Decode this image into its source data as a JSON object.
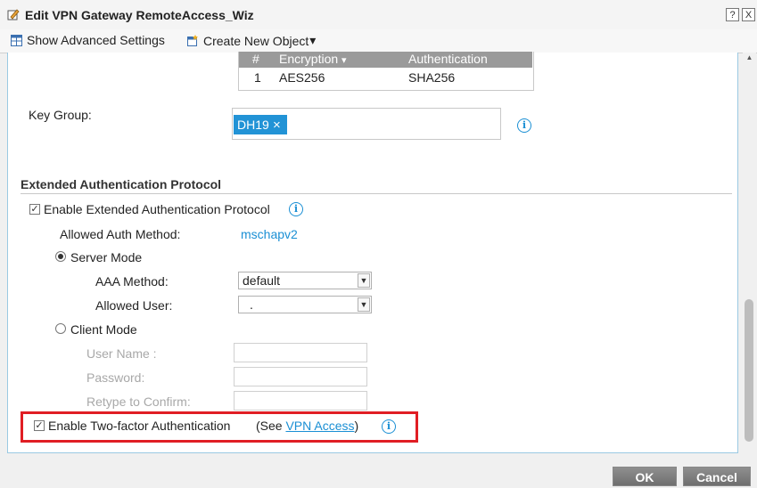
{
  "window": {
    "title": "Edit VPN Gateway RemoteAccess_Wiz",
    "help_label": "?",
    "close_label": "X"
  },
  "toolbar": {
    "show_advanced": "Show Advanced Settings",
    "create_object": "Create New Object",
    "create_object_arrow": "▾"
  },
  "proposal_table": {
    "headers": {
      "num": "#",
      "encryption": "Encryption",
      "authentication": "Authentication",
      "sort_icon": "▾"
    },
    "rows": [
      {
        "num": "1",
        "encryption": "AES256",
        "authentication": "SHA256"
      }
    ]
  },
  "key_group": {
    "label": "Key Group:",
    "tag": "DH19",
    "tag_remove": "×",
    "info_icon": "i"
  },
  "xauth": {
    "section_title": "Extended Authentication Protocol",
    "enable_label": "Enable Extended Authentication Protocol",
    "enable_checked": true,
    "check_mark": "✓",
    "info_icon": "i",
    "allowed_auth_label": "Allowed Auth Method:",
    "allowed_auth_value": "mschapv2",
    "server_mode_label": "Server Mode",
    "aaa_method_label": "AAA Method:",
    "aaa_method_value": "default",
    "allowed_user_label": "Allowed User:",
    "allowed_user_value": ".",
    "select_arrow": "▼",
    "client_mode_label": "Client Mode",
    "user_name_label": "User Name :",
    "password_label": "Password:",
    "retype_label": "Retype to Confirm:"
  },
  "two_factor": {
    "label": "Enable Two-factor Authentication",
    "checked": true,
    "see_prefix": "(See",
    "link_text": "VPN Access",
    "see_suffix": ")",
    "info_icon": "i"
  },
  "buttons": {
    "ok": "OK",
    "cancel": "Cancel"
  },
  "colors": {
    "accent": "#1a8fd4",
    "highlight": "#e01e24",
    "tag": "#2293d6"
  }
}
